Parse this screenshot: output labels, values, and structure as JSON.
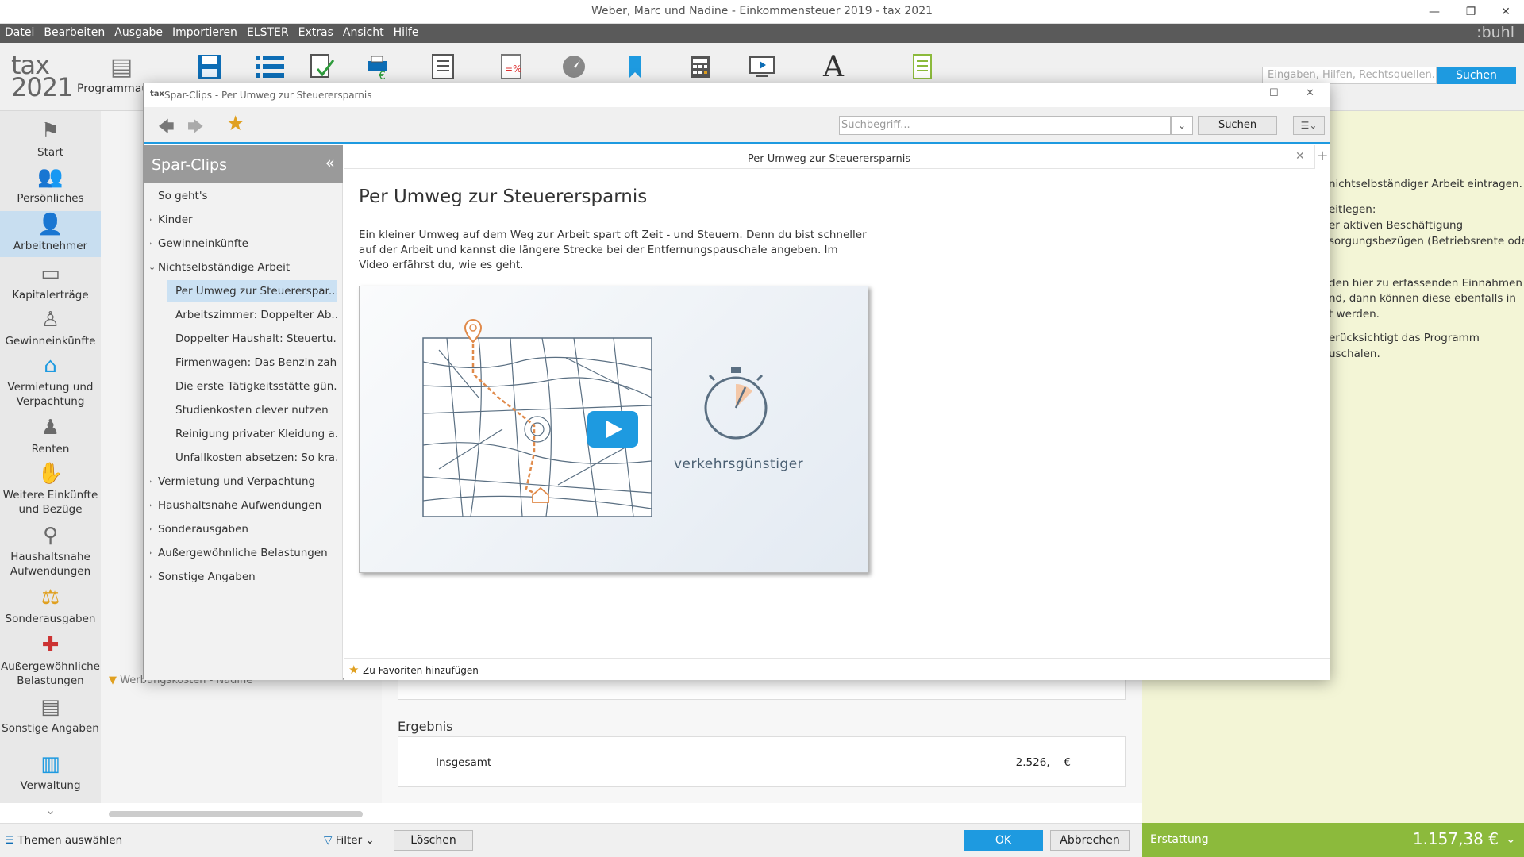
{
  "window": {
    "title": "Weber, Marc und Nadine - Einkommensteuer 2019 - tax 2021"
  },
  "menu": [
    "Datei",
    "Bearbeiten",
    "Ausgabe",
    "Importieren",
    "ELSTER",
    "Extras",
    "Ansicht",
    "Hilfe"
  ],
  "brand": ":buhl",
  "logo": {
    "line1": "tax",
    "line2": "2021"
  },
  "toolbar": {
    "first_label": "Programmaus",
    "search_placeholder": "Eingaben, Hilfen, Rechtsquellen...",
    "search_button": "Suchen"
  },
  "leftnav": [
    {
      "label": "Start",
      "icon": "signpost-icon"
    },
    {
      "label": "Persönliches",
      "icon": "persons-icon"
    },
    {
      "label": "Arbeitnehmer",
      "icon": "employee-icon"
    },
    {
      "label": "Kapitalerträge",
      "icon": "capital-icon"
    },
    {
      "label": "Gewinneinkünfte",
      "icon": "business-person-icon"
    },
    {
      "label": "Vermietung und Verpachtung",
      "icon": "house-icon"
    },
    {
      "label": "Renten",
      "icon": "pensioner-icon"
    },
    {
      "label": "Weitere Einkünfte und Bezüge",
      "icon": "coins-hand-icon"
    },
    {
      "label": "Haushaltsnahe Aufwendungen",
      "icon": "household-icon"
    },
    {
      "label": "Sonderausgaben",
      "icon": "special-expenses-icon"
    },
    {
      "label": "Außergewöhnliche Belastungen",
      "icon": "medical-kit-icon"
    },
    {
      "label": "Sonstige Angaben",
      "icon": "document-icon"
    },
    {
      "label": "Verwaltung",
      "icon": "folders-icon"
    }
  ],
  "tree": {
    "partial_row": "Werbungskosten - Nadine"
  },
  "content": {
    "ergebnis_title": "Ergebnis",
    "insgesamt_label": "Insgesamt",
    "insgesamt_value": "2.526,— €"
  },
  "rightpanel": {
    "lines": [
      "nichtselbständiger Arbeit eintragen.",
      "eitlegen:",
      "er aktiven Beschäftigung",
      "sorgungsbezügen (Betriebsrente oder",
      "den hier zu erfassenden Einnahmen",
      "nd, dann können diese ebenfalls in",
      "t werden.",
      "erücksichtigt das Programm",
      "uschalen."
    ]
  },
  "statusbar": {
    "themes": "Themen auswählen",
    "filter": "Filter",
    "delete": "Löschen",
    "ok": "OK",
    "cancel": "Abbrechen",
    "refund_label": "Erstattung",
    "refund_value": "1.157,38 €"
  },
  "dialog": {
    "title": "Spar-Clips - Per Umweg zur Steuerersparnis",
    "search_placeholder": "Suchbegriff...",
    "search_button": "Suchen",
    "sidebar_title": "Spar-Clips",
    "sidebar_items": [
      {
        "label": "So geht's",
        "level": 0,
        "chevron": ""
      },
      {
        "label": "Kinder",
        "level": 0,
        "chevron": "›"
      },
      {
        "label": "Gewinneinkünfte",
        "level": 0,
        "chevron": "›"
      },
      {
        "label": "Nichtselbständige Arbeit",
        "level": 0,
        "chevron": "⌄"
      },
      {
        "label": "Per Umweg zur Steuererspar...",
        "level": 1,
        "chevron": "",
        "active": true
      },
      {
        "label": "Arbeitszimmer: Doppelter Ab...",
        "level": 1,
        "chevron": ""
      },
      {
        "label": "Doppelter Haushalt: Steuertu...",
        "level": 1,
        "chevron": ""
      },
      {
        "label": "Firmenwagen: Das Benzin zah...",
        "level": 1,
        "chevron": ""
      },
      {
        "label": "Die erste Tätigkeitsstätte gün...",
        "level": 1,
        "chevron": ""
      },
      {
        "label": "Studienkosten clever nutzen",
        "level": 1,
        "chevron": ""
      },
      {
        "label": "Reinigung privater Kleidung a...",
        "level": 1,
        "chevron": ""
      },
      {
        "label": "Unfallkosten absetzen: So kra...",
        "level": 1,
        "chevron": ""
      },
      {
        "label": "Vermietung und Verpachtung",
        "level": 0,
        "chevron": "›"
      },
      {
        "label": "Haushaltsnahe Aufwendungen",
        "level": 0,
        "chevron": "›"
      },
      {
        "label": "Sonderausgaben",
        "level": 0,
        "chevron": "›"
      },
      {
        "label": "Außergewöhnliche Belastungen",
        "level": 0,
        "chevron": "›"
      },
      {
        "label": "Sonstige Angaben",
        "level": 0,
        "chevron": "›"
      }
    ],
    "doc_tab_title": "Per Umweg zur Steuerersparnis",
    "heading": "Per Umweg zur Steuerersparnis",
    "description": "Ein kleiner Umweg auf dem Weg zur Arbeit spart oft Zeit - und Steuern. Denn du bist schneller auf der Arbeit und kannst die längere Strecke bei der Entfernungspauschale angeben. Im Video erfährst du, wie es geht.",
    "video_caption": "verkehrsgünstiger",
    "favorites": "Zu Favoriten hinzufügen"
  },
  "colors": {
    "accent": "#1e9ae0",
    "refund": "#8cba3c",
    "rightpanel": "#f3f5d6",
    "star": "#e0a020"
  }
}
